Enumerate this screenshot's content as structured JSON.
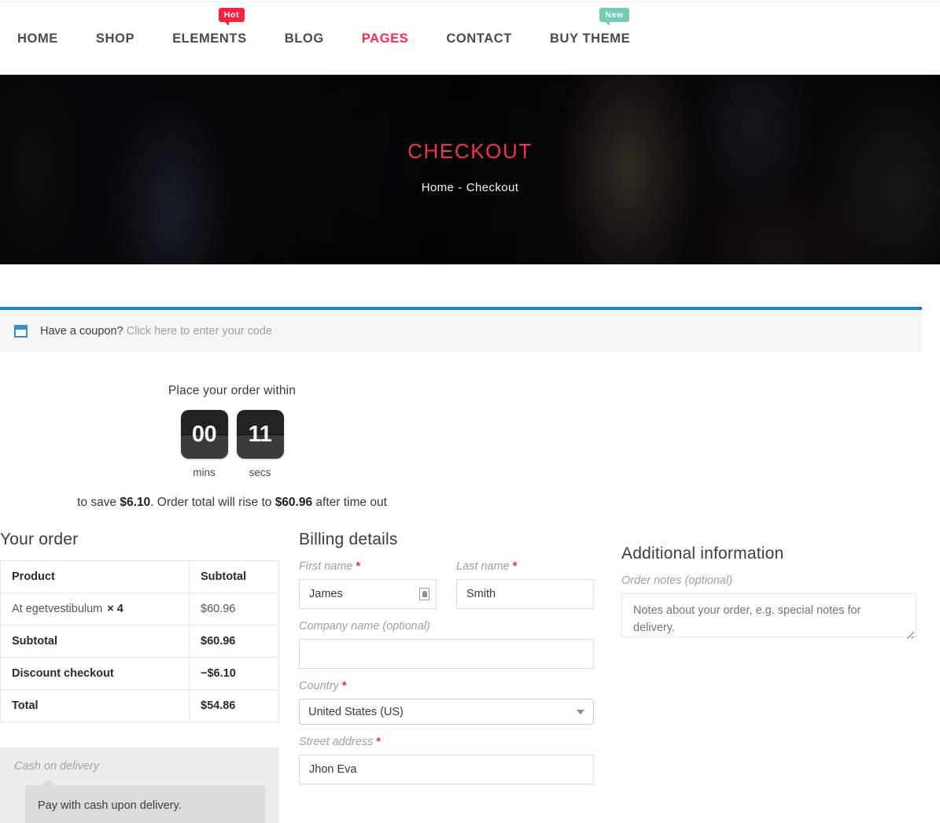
{
  "nav": {
    "items": [
      {
        "label": "HOME",
        "active": false,
        "badge": null
      },
      {
        "label": "SHOP",
        "active": false,
        "badge": null
      },
      {
        "label": "ELEMENTS",
        "active": false,
        "badge": "Hot"
      },
      {
        "label": "BLOG",
        "active": false,
        "badge": null
      },
      {
        "label": "PAGES",
        "active": true,
        "badge": null
      },
      {
        "label": "CONTACT",
        "active": false,
        "badge": null
      },
      {
        "label": "BUY THEME",
        "active": false,
        "badge": "New"
      }
    ],
    "badge_hot": "Hot",
    "badge_new": "New",
    "active_color": "#ff2b4e",
    "badge_hot_color": "#f8233f",
    "badge_new_color": "#72cbb4"
  },
  "hero": {
    "title": "CHECKOUT",
    "title_color": "#f2334f",
    "breadcrumb_home": "Home",
    "breadcrumb_sep": "-",
    "breadcrumb_current": "Checkout"
  },
  "coupon": {
    "prompt": "Have a coupon?",
    "link": "Click here to enter your code",
    "icon": "coupon-tag-icon",
    "accent_color": "#2580c2"
  },
  "countdown": {
    "heading": "Place your order within",
    "units": [
      {
        "value": "00",
        "label": "mins"
      },
      {
        "value": "11",
        "label": "secs"
      }
    ],
    "footer_pre": "to save ",
    "footer_save": "$6.10",
    "footer_mid": ". Order total will rise to ",
    "footer_total": "$60.96",
    "footer_post": " after time out"
  },
  "order": {
    "title": "Your order",
    "columns": [
      "Product",
      "Subtotal"
    ],
    "rows": [
      {
        "label": "At egetvestibulum",
        "qty": "× 4",
        "value": "$60.96",
        "strong": false
      },
      {
        "label": "Subtotal",
        "qty": "",
        "value": "$60.96",
        "strong": true
      },
      {
        "label": "Discount checkout",
        "qty": "",
        "value": "−$6.10",
        "strong": true
      },
      {
        "label": "Total",
        "qty": "",
        "value": "$54.86",
        "strong": true
      }
    ]
  },
  "payment": {
    "method_label": "Cash on delivery",
    "description": "Pay with cash upon delivery."
  },
  "billing": {
    "title": "Billing details",
    "first_name": {
      "label": "First name",
      "required": "*",
      "value": "James"
    },
    "last_name": {
      "label": "Last name",
      "required": "*",
      "value": "Smith"
    },
    "company": {
      "label": "Company name (optional)",
      "value": ""
    },
    "country": {
      "label": "Country",
      "required": "*",
      "value": "United States (US)"
    },
    "street": {
      "label": "Street address",
      "required": "*",
      "value": "Jhon Eva"
    }
  },
  "additional": {
    "title": "Additional information",
    "notes_label": "Order notes (optional)",
    "notes_placeholder": "Notes about your order, e.g. special notes for delivery.",
    "notes_value": ""
  }
}
